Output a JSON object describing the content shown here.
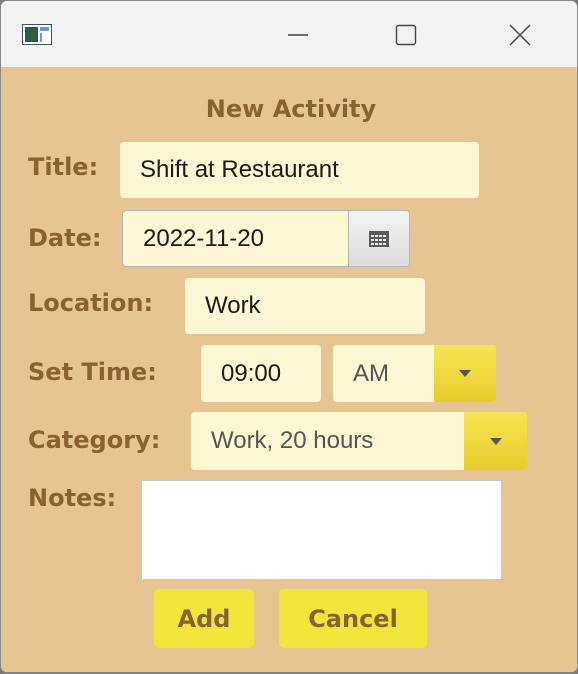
{
  "window": {
    "icon": "app-window-icon",
    "controls": {
      "minimize_icon": "minimize-icon",
      "maximize_icon": "maximize-icon",
      "close_icon": "close-icon"
    }
  },
  "form": {
    "heading": "New Activity",
    "title": {
      "label": "Title:",
      "value": "Shift at Restaurant"
    },
    "date": {
      "label": "Date:",
      "value": "2022-11-20",
      "picker_icon": "calendar-icon"
    },
    "location": {
      "label": "Location:",
      "value": "Work"
    },
    "time": {
      "label": "Set Time:",
      "value": "09:00",
      "period": "AM"
    },
    "category": {
      "label": "Category:",
      "value": "Work, 20 hours"
    },
    "notes": {
      "label": "Notes:",
      "value": ""
    }
  },
  "buttons": {
    "add": "Add",
    "cancel": "Cancel"
  },
  "colors": {
    "background": "#e6c593",
    "label_text": "#8a6131",
    "field_fill": "#fdf7d3",
    "button_fill": "#f4e53a"
  }
}
